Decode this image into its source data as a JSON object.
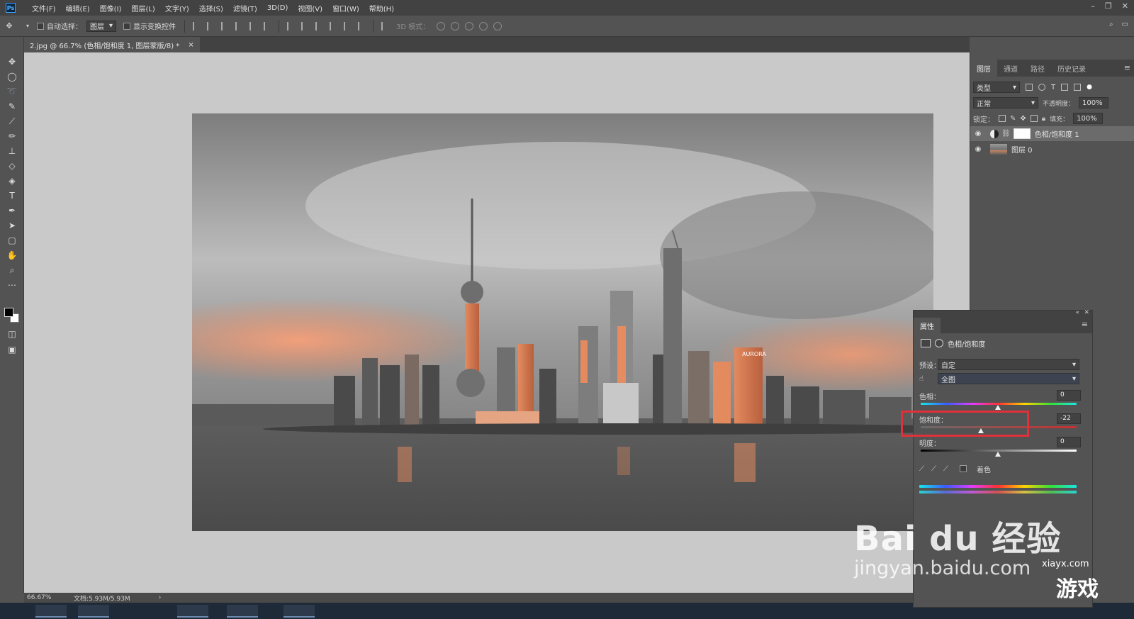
{
  "app": {
    "logo": "Ps"
  },
  "menu": [
    "文件(F)",
    "编辑(E)",
    "图像(I)",
    "图层(L)",
    "文字(Y)",
    "选择(S)",
    "滤镜(T)",
    "3D(D)",
    "视图(V)",
    "窗口(W)",
    "帮助(H)"
  ],
  "options": {
    "auto_select_label": "自动选择：",
    "auto_select_value": "图层",
    "show_transform_label": "显示变换控件",
    "mode_3d_label": "3D 模式："
  },
  "document": {
    "tab_title": "2.jpg @ 66.7% (色相/饱和度 1, 图层蒙版/8) *",
    "tab_close": "×"
  },
  "status": {
    "zoom": "66.67%",
    "doc_size": "文档:5.93M/5.93M",
    "arrow": "›"
  },
  "layers_panel": {
    "tabs": [
      "图层",
      "通道",
      "路径",
      "历史记录"
    ],
    "filter_label": "类型",
    "blend_mode": "正常",
    "opacity_label": "不透明度：",
    "opacity_value": "100%",
    "lock_label": "锁定：",
    "fill_label": "填充：",
    "fill_value": "100%",
    "layers": [
      {
        "name": "色相/饱和度 1",
        "selected": true
      },
      {
        "name": "图层 0",
        "selected": false
      }
    ]
  },
  "properties_panel": {
    "tab": "属性",
    "title": "色相/饱和度",
    "preset_label": "预设：",
    "preset_value": "自定",
    "channel_value": "全图",
    "hue_label": "色相：",
    "hue_value": "0",
    "saturation_label": "饱和度：",
    "saturation_value": "-22",
    "lightness_label": "明度：",
    "lightness_value": "0",
    "colorize_label": "着色"
  },
  "image": {
    "building_sign": "AURORA"
  },
  "watermark": {
    "brand": "Bai du 经验",
    "url": "jingyan.baidu.com",
    "site": "xiayx.com",
    "game": "游戏"
  },
  "colors": {
    "accent": "#e0303a",
    "panel_bg": "#535353",
    "canvas_bg": "#c9c9c9",
    "glow": "#f0895c"
  }
}
